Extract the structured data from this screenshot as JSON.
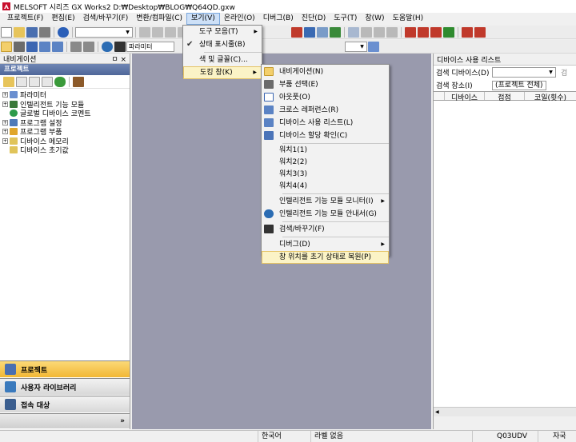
{
  "window": {
    "title": "MELSOFT 시리즈 GX Works2 D:₩Desktop₩BLOG₩Q64QD.gxw"
  },
  "menubar": [
    "프로젝트(F)",
    "편집(E)",
    "검색/바꾸기(F)",
    "변환/컴파일(C)",
    "보기(V)",
    "온라인(O)",
    "디버그(B)",
    "진단(D)",
    "도구(T)",
    "창(W)",
    "도움말(H)"
  ],
  "toolbar": {
    "combo_left": "",
    "combo_mid": "파라미터",
    "combo_right": ""
  },
  "nav_panel": {
    "title": "내비게이션",
    "pin": "ㅁ ×",
    "section": "프로젝트",
    "tree": [
      "파라미터",
      "인텔리전트 기능 모듈",
      "글로벌 디바이스 코멘트",
      "프로그램 설정",
      "프로그램 부품",
      "디바이스 메모리",
      "디바이스 초기값"
    ],
    "buttons": [
      "프로젝트",
      "사용자 라이브러리",
      "접속 대상"
    ],
    "more": "»"
  },
  "right_panel": {
    "title": "디바이스 사용 리스트",
    "search_device_label": "검색 디바이스(D)",
    "search_device_value": "",
    "search_btn": "검",
    "search_place_label": "검색 장소(I)",
    "search_place_value": "(프로젝트 전체)",
    "col_headers": [
      "디바이스",
      "접점",
      "코일(횟수)"
    ]
  },
  "view_menu": {
    "items": [
      "도구 모음(T)",
      "상태 표시줄(B)",
      "색 및 글꼴(C)...",
      "도킹 창(K)"
    ]
  },
  "docking_submenu": {
    "items": [
      "내비게이션(N)",
      "부품 선택(E)",
      "아웃풋(O)",
      "크로스 레퍼런스(R)",
      "디바이스 사용 리스트(L)",
      "디바이스 할당 확인(C)",
      "워치1(1)",
      "워치2(2)",
      "워치3(3)",
      "워치4(4)",
      "인텔리전트 기능 모듈 모니터(I)",
      "인텔리전트 기능 모듈 안내서(G)",
      "검색/바꾸기(F)",
      "디버그(D)",
      "창 위치를 초기 상태로 복원(P)"
    ]
  },
  "statusbar": {
    "lang": "한국어",
    "label": "라벨 없음",
    "cpu": "Q03UDV",
    "station": "자국"
  },
  "colors": {
    "accent": "#f7c65a",
    "workspace": "#999aad",
    "nav_header": "#5670a3"
  }
}
